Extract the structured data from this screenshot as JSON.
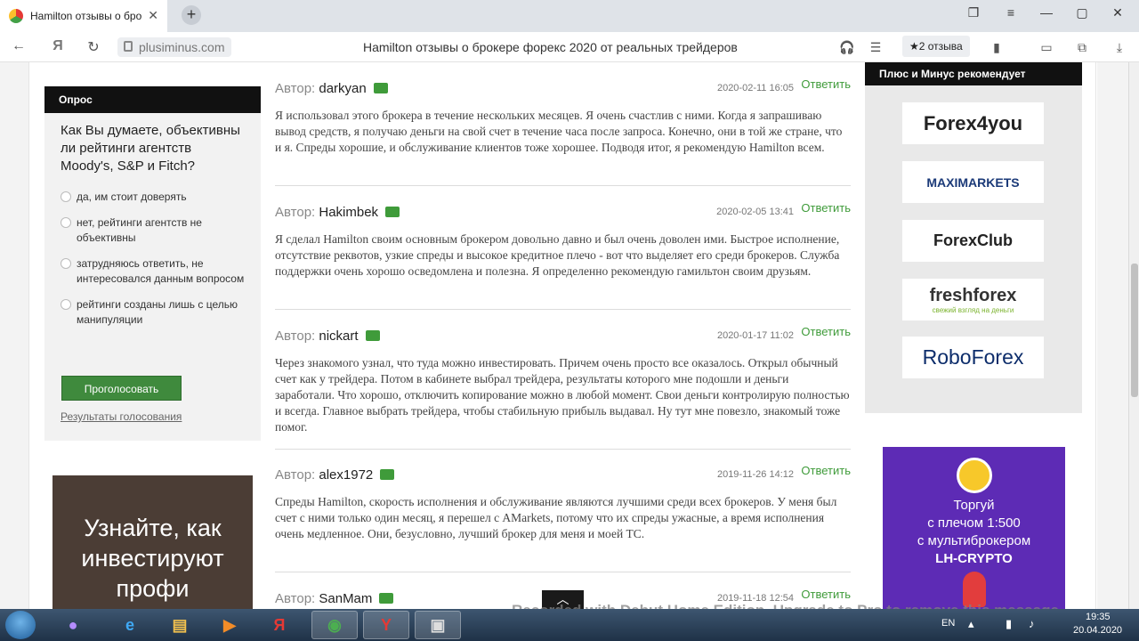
{
  "browser": {
    "tab_title": "Hamilton отзывы о бро",
    "url": "plusiminus.com",
    "page_heading": "Hamilton отзывы о брокере форекс 2020 от реальных трейдеров",
    "reviews_button": "★2 отзыва",
    "icons": [
      "back-icon",
      "yandex-icon",
      "reload-icon",
      "lock-icon",
      "headphones-icon",
      "reader-icon",
      "bookmark-icon",
      "battery-icon",
      "share-icon",
      "download-icon"
    ]
  },
  "poll": {
    "header": "Опрос",
    "question": "Как Вы думаете, объективны ли рейтинги агентств Moody's, S&P и Fitch?",
    "options": [
      "да, им стоит доверять",
      "нет, рейтинги агентств не объективны",
      "затрудняюсь ответить, не интересовался данным вопросом",
      "рейтинги созданы лишь с целью манипуляции"
    ],
    "vote_label": "Проголосовать",
    "results_link": "Результаты голосования"
  },
  "left_ad": {
    "text": "Узнайте, как инвестируют профи"
  },
  "comments": {
    "author_label": "Автор:",
    "reply_label": "Ответить",
    "items": [
      {
        "author": "darkyan",
        "date": "2020-02-11 16:05",
        "text": "Я использовал этого брокера в течение нескольких месяцев. Я очень счастлив с ними. Когда я запрашиваю вывод средств, я получаю деньги на свой счет в течение часа после запроса. Конечно, они в той же стране, что и я. Спреды хорошие, и обслуживание клиентов тоже хорошее. Подводя итог, я рекомендую Hamilton всем."
      },
      {
        "author": "Hakimbek",
        "date": "2020-02-05 13:41",
        "text": "Я сделал Hamilton своим основным брокером довольно давно и был очень доволен ими. Быстрое исполнение, отсутствие реквотов, узкие спреды и высокое кредитное плечо - вот что выделяет его среди брокеров. Служба поддержки очень хорошо осведомлена и полезна. Я определенно рекомендую гамильтон своим друзьям."
      },
      {
        "author": "nickart",
        "date": "2020-01-17 11:02",
        "text": "Через знакомого узнал, что туда можно инвестировать. Причем очень просто все оказалось. Открыл обычный счет как у трейдера. Потом в кабинете выбрал трейдера, результаты которого мне подошли и деньги заработали. Что хорошо, отключить копирование можно в любой момент. Свои деньги контролирую полностью и всегда. Главное выбрать трейдера, чтобы стабильную прибыль выдавал. Ну тут мне повезло, знакомый тоже помог."
      },
      {
        "author": "alex1972",
        "date": "2019-11-26 14:12",
        "text": "Спреды Hamilton, скорость исполнения и обслуживание являются лучшими среди всех брокеров. У меня был счет с ними только один месяц, я перешел с AMarkets, потому что их спреды ужасные, а время исполнения очень медленное. Они, безусловно, лучший брокер для меня и моей ТС."
      },
      {
        "author": "SanMam",
        "date": "2019-11-18 12:54",
        "text": ""
      }
    ]
  },
  "recommend": {
    "header": "Плюс и Минус рекомендует",
    "logos": [
      "Forex4you",
      "MAXIMARKETS",
      "ForexClub",
      "freshforex",
      "RoboForex"
    ],
    "fresh_tagline": "свежий взгляд на деньги"
  },
  "right_ad": {
    "line1": "Торгуй",
    "line2": "с плечом 1:500",
    "line3": "с мультиброкером",
    "line4": "LH-CRYPTO"
  },
  "watermark": "Recorded with Debut Home Edition. Upgrade to Pro to remove this message",
  "taskbar": {
    "lang": "EN",
    "time": "19:35",
    "date": "20.04.2020"
  },
  "colors": {
    "accent_green": "#3f9b3a",
    "dark_header": "#111111",
    "ad_purple": "#5d2bb5"
  }
}
